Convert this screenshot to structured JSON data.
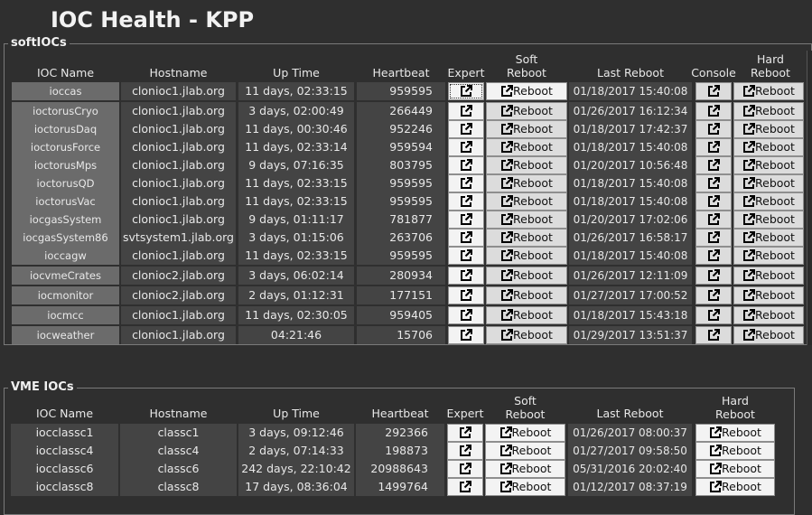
{
  "title": "IOC Health - KPP",
  "soft": {
    "label": "softIOCs",
    "headers": {
      "name": "IOC Name",
      "host": "Hostname",
      "uptime": "Up Time",
      "heartbeat": "Heartbeat",
      "expert": "Expert",
      "soft_reboot": [
        "Soft",
        "Reboot"
      ],
      "last_reboot": "Last Reboot",
      "console": "Console",
      "hard_reboot": [
        "Hard",
        "Reboot"
      ]
    },
    "reboot_label": "Reboot",
    "rows": [
      {
        "name": "ioccas",
        "host": "clonioc1.jlab.org",
        "uptime": "11 days, 02:33:15",
        "heartbeat": "959595",
        "last": "01/18/2017 15:40:08"
      },
      {
        "name": "ioctorusCryo",
        "host": "clonioc1.jlab.org",
        "uptime": "3 days, 02:00:49",
        "heartbeat": "266449",
        "last": "01/26/2017 16:12:34"
      },
      {
        "name": "ioctorusDaq",
        "host": "clonioc1.jlab.org",
        "uptime": "11 days, 00:30:46",
        "heartbeat": "952246",
        "last": "01/18/2017 17:42:37"
      },
      {
        "name": "ioctorusForce",
        "host": "clonioc1.jlab.org",
        "uptime": "11 days, 02:33:14",
        "heartbeat": "959594",
        "last": "01/18/2017 15:40:08"
      },
      {
        "name": "ioctorusMps",
        "host": "clonioc1.jlab.org",
        "uptime": "9 days, 07:16:35",
        "heartbeat": "803795",
        "last": "01/20/2017 10:56:48"
      },
      {
        "name": "ioctorusQD",
        "host": "clonioc1.jlab.org",
        "uptime": "11 days, 02:33:15",
        "heartbeat": "959595",
        "last": "01/18/2017 15:40:08"
      },
      {
        "name": "ioctorusVac",
        "host": "clonioc1.jlab.org",
        "uptime": "11 days, 02:33:15",
        "heartbeat": "959595",
        "last": "01/18/2017 15:40:08"
      },
      {
        "name": "iocgasSystem",
        "host": "clonioc1.jlab.org",
        "uptime": "9 days, 01:11:17",
        "heartbeat": "781877",
        "last": "01/20/2017 17:02:06"
      },
      {
        "name": "iocgasSystem86",
        "host": "svtsystem1.jlab.org",
        "uptime": "3 days, 01:15:06",
        "heartbeat": "263706",
        "last": "01/26/2017 16:58:17"
      },
      {
        "name": "ioccagw",
        "host": "clonioc1.jlab.org",
        "uptime": "11 days, 02:33:15",
        "heartbeat": "959595",
        "last": "01/18/2017 15:40:08"
      },
      {
        "name": "iocvmeCrates",
        "host": "clonioc2.jlab.org",
        "uptime": "3 days, 06:02:14",
        "heartbeat": "280934",
        "last": "01/26/2017 12:11:09"
      },
      {
        "name": "iocmonitor",
        "host": "clonioc2.jlab.org",
        "uptime": "2 days, 01:12:31",
        "heartbeat": "177151",
        "last": "01/27/2017 17:00:52"
      },
      {
        "name": "iocmcc",
        "host": "clonioc1.jlab.org",
        "uptime": "11 days, 02:30:05",
        "heartbeat": "959405",
        "last": "01/18/2017 15:43:18"
      },
      {
        "name": "iocweather",
        "host": "clonioc1.jlab.org",
        "uptime": "04:21:46",
        "heartbeat": "15706",
        "last": "01/29/2017 13:51:37"
      }
    ]
  },
  "vme": {
    "label": "VME IOCs",
    "headers": {
      "name": "IOC Name",
      "host": "Hostname",
      "uptime": "Up Time",
      "heartbeat": "Heartbeat",
      "expert": "Expert",
      "soft_reboot": [
        "Soft",
        "Reboot"
      ],
      "last_reboot": "Last Reboot",
      "hard_reboot": [
        "Hard",
        "Reboot"
      ]
    },
    "reboot_label": "Reboot",
    "rows": [
      {
        "name": "iocclassc1",
        "host": "classc1",
        "uptime": "3 days, 09:12:46",
        "heartbeat": "292366",
        "last": "01/26/2017 08:00:37"
      },
      {
        "name": "iocclassc4",
        "host": "classc4",
        "uptime": "2 days, 07:14:33",
        "heartbeat": "198873",
        "last": "01/27/2017 09:58:50"
      },
      {
        "name": "iocclassc6",
        "host": "classc6",
        "uptime": "242 days, 22:10:42",
        "heartbeat": "20988643",
        "last": "05/31/2016 20:02:40"
      },
      {
        "name": "iocclassc8",
        "host": "classc8",
        "uptime": "17 days, 08:36:04",
        "heartbeat": "1499764",
        "last": "01/12/2017 08:37:19"
      }
    ]
  },
  "icons": {
    "external_link": "external-link-icon"
  }
}
